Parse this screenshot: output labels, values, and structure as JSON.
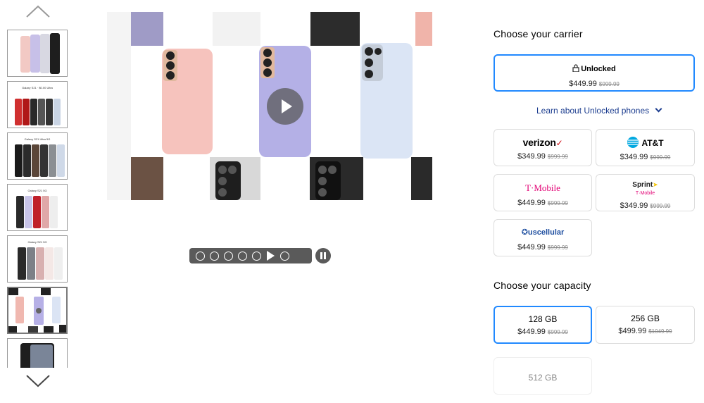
{
  "gallery": {
    "thumbnails": [
      {
        "caption": ""
      },
      {
        "caption": "Galaxy S21 · $0.00 Ultra"
      },
      {
        "caption": "Galaxy S21 Ultra 5G"
      },
      {
        "caption": "Galaxy S21 5G"
      },
      {
        "caption": "Galaxy S21 5G"
      },
      {
        "caption": ""
      },
      {
        "caption": ""
      }
    ],
    "up_icon": "chevron-up-icon",
    "down_icon": "chevron-down-icon",
    "play_icon": "play-icon",
    "pause_icon": "pause-icon"
  },
  "carrier": {
    "heading": "Choose your carrier",
    "unlocked": {
      "label": "Unlocked",
      "price": "$449.99",
      "original": "$999.99"
    },
    "learn_link": "Learn about Unlocked phones",
    "options": [
      {
        "name": "verizon",
        "price": "$349.99",
        "original": "$999.99"
      },
      {
        "name": "AT&T",
        "price": "$349.99",
        "original": "$999.99"
      },
      {
        "name": "T·Mobile",
        "price": "$449.99",
        "original": "$999.99"
      },
      {
        "name_line1": "Sprint",
        "name_line2": "T·Mobile",
        "price": "$349.99",
        "original": "$999.99"
      },
      {
        "name": "uscellular",
        "price": "$449.99",
        "original": "$999.99"
      }
    ]
  },
  "capacity": {
    "heading": "Choose your capacity",
    "options": [
      {
        "label": "128 GB",
        "price": "$449.99",
        "original": "$999.99"
      },
      {
        "label": "256 GB",
        "price": "$499.99",
        "original": "$1049.99"
      },
      {
        "label": "512 GB"
      }
    ]
  },
  "colors": {
    "accent": "#2189ff",
    "link": "#1c3d8f",
    "verizon_red": "#cd040b",
    "att_blue": "#00a8e0",
    "tmobile_magenta": "#e20074",
    "uscellular_blue": "#1f4fa0",
    "uscellular_red": "#d71920"
  }
}
